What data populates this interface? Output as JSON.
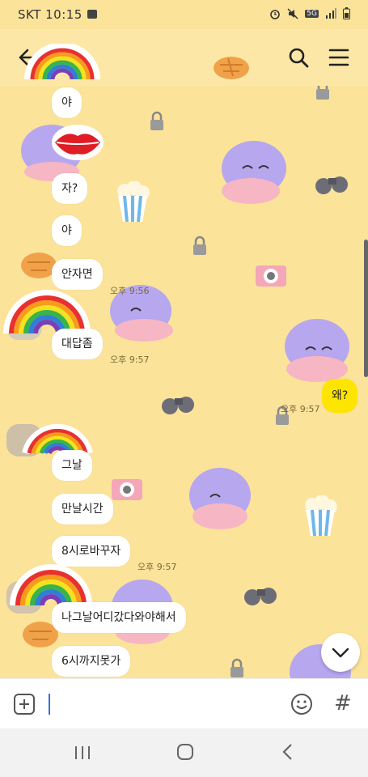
{
  "status_bar": {
    "carrier_time": "SKT 10:15",
    "network": "5G"
  },
  "header": {
    "back_icon": "arrow-left-icon",
    "search_icon": "search-icon",
    "menu_icon": "hamburger-menu-icon"
  },
  "messages": [
    {
      "text": "야",
      "side": "left"
    },
    {
      "text": "자?",
      "side": "left"
    },
    {
      "text": "야",
      "side": "left"
    },
    {
      "text": "안자면",
      "side": "left",
      "time": "오후 9:56"
    },
    {
      "text": "대답좀",
      "side": "left",
      "time": "오후 9:57"
    },
    {
      "text": "왜?",
      "side": "right",
      "time": "오후 9:57"
    },
    {
      "text": "그날",
      "side": "left"
    },
    {
      "text": "만날시간",
      "side": "left"
    },
    {
      "text": "8시로바꾸자",
      "side": "left",
      "time": "오후 9:57"
    },
    {
      "text": "나그날어디갔다와야해서",
      "side": "left"
    },
    {
      "text": "6시까지못가",
      "side": "left"
    }
  ],
  "input_bar": {
    "value": "",
    "plus_icon": "plus-square-icon",
    "emoji_icon": "smiley-icon",
    "hash_icon": "hashtag-icon",
    "hash_glyph": "#"
  },
  "colors": {
    "background": "#fbe39a",
    "my_bubble": "#fee500",
    "their_bubble": "#ffffff",
    "cursor": "#3a6de0"
  }
}
